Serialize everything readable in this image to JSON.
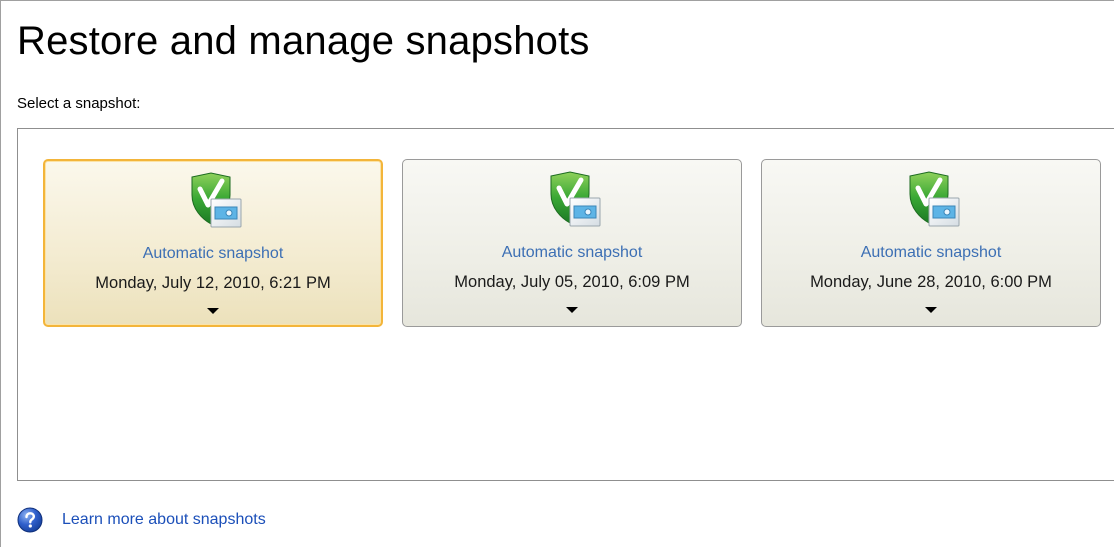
{
  "page": {
    "title": "Restore and manage snapshots",
    "select_label": "Select a snapshot:"
  },
  "snapshots": [
    {
      "name": "Automatic snapshot",
      "date": "Monday, July 12, 2010, 6:21 PM",
      "selected": true,
      "icon": "snapshot-check-icon"
    },
    {
      "name": "Automatic snapshot",
      "date": "Monday, July 05, 2010, 6:09 PM",
      "selected": false,
      "icon": "snapshot-check-icon"
    },
    {
      "name": "Automatic snapshot",
      "date": "Monday, June 28, 2010, 6:00 PM",
      "selected": false,
      "icon": "snapshot-check-icon"
    }
  ],
  "help": {
    "icon": "help-icon",
    "link_text": "Learn more about snapshots"
  },
  "colors": {
    "link": "#1b4fb9",
    "snapshot_name": "#3c6fb4",
    "selected_border": "#f3b53a",
    "check_green": "#2f9a2f"
  }
}
